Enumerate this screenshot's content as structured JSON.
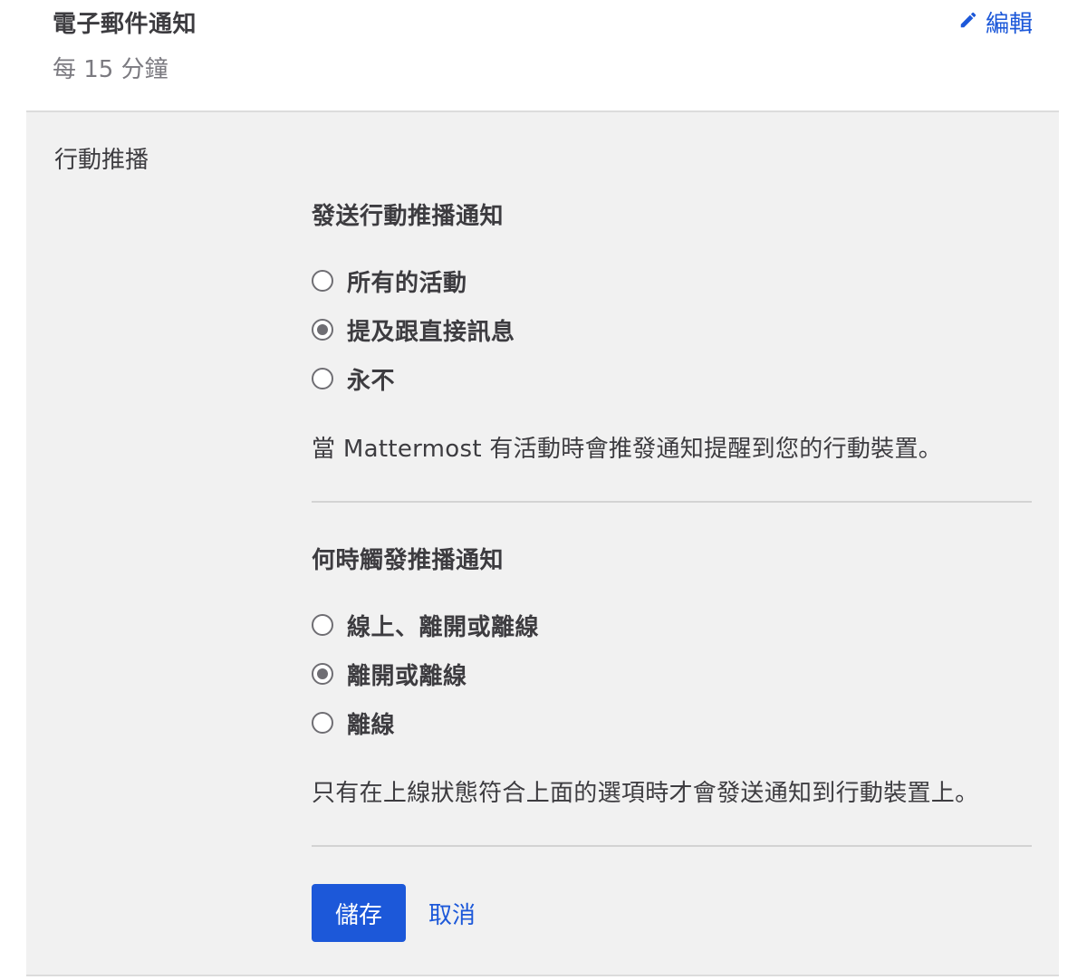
{
  "email": {
    "title": "電子郵件通知",
    "value": "每 15 分鐘",
    "edit_label": "編輯",
    "edit_icon": "pencil-icon"
  },
  "push": {
    "title": "行動推播",
    "send": {
      "legend": "發送行動推播通知",
      "options": [
        {
          "label": "所有的活動",
          "checked": false
        },
        {
          "label": "提及跟直接訊息",
          "checked": true
        },
        {
          "label": "永不",
          "checked": false
        }
      ],
      "help": "當 Mattermost 有活動時會推發通知提醒到您的行動裝置。"
    },
    "trigger": {
      "legend": "何時觸發推播通知",
      "options": [
        {
          "label": "線上、離開或離線",
          "checked": false
        },
        {
          "label": "離開或離線",
          "checked": true
        },
        {
          "label": "離線",
          "checked": false
        }
      ],
      "help": "只有在上線狀態符合上面的選項時才會發送通知到行動裝置上。"
    },
    "save_label": "儲存",
    "cancel_label": "取消"
  },
  "colors": {
    "accent": "#1c58d9",
    "section_bg": "#f1f1f1",
    "text": "#3d3c40",
    "muted": "#7b7a80"
  }
}
